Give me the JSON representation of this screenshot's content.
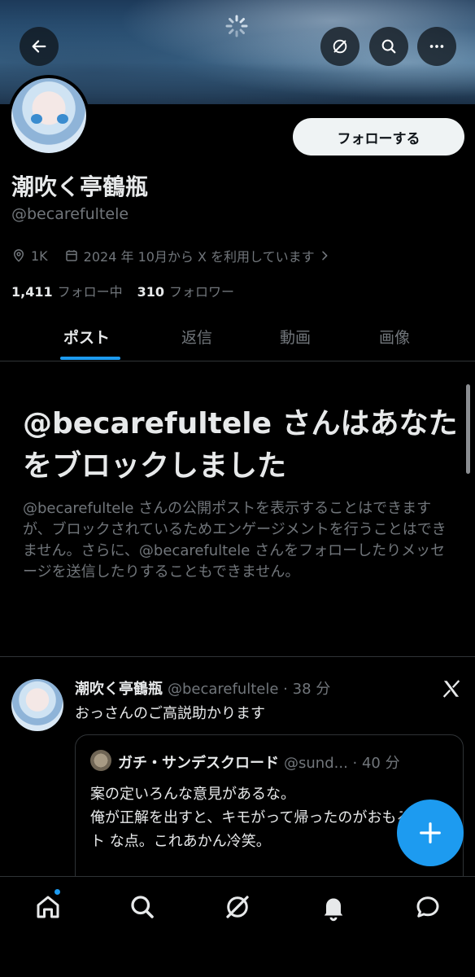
{
  "profile": {
    "follow_label": "フォローする",
    "display_name": "潮吹く亭鶴瓶",
    "handle": "@becarefultele",
    "location": "1K",
    "joined": "2024 年 10月から X を利用しています",
    "following_count": "1,411",
    "following_label": "フォロー中",
    "followers_count": "310",
    "followers_label": "フォロワー"
  },
  "tabs": [
    {
      "label": "ポスト",
      "active": true
    },
    {
      "label": "返信"
    },
    {
      "label": "動画"
    },
    {
      "label": "画像"
    }
  ],
  "blocked": {
    "title": "@becarefultele さんはあなたをブロックしました",
    "body": "@becarefultele さんの公開ポストを表示することはできますが、ブロックされているためエンゲージメントを行うことはできません。さらに、@becarefultele さんをフォローしたりメッセージを送信したりすることもできません。"
  },
  "post": {
    "name": "潮吹く亭鶴瓶",
    "handle_time": "@becarefultele · 38 分",
    "text": "おっさんのご高説助かります",
    "quote": {
      "name": "ガチ・サンデスクロード",
      "handle_time": "@sund... · 40 分",
      "line1": "案の定いろんな意見があるな。",
      "line2": "俺が正解を出すと、キモがって帰ったのがおもろ",
      "line3": "ト な点。これあかん冷笑。"
    }
  },
  "colors": {
    "accent": "#1d9bf0",
    "background": "#000000",
    "text_primary": "#e7e9ea",
    "text_secondary": "#71767b"
  },
  "icons": {
    "back": "arrow-left-icon",
    "grok": "grok-icon",
    "search": "search-icon",
    "more": "more-icon",
    "location": "location-pin-icon",
    "calendar": "calendar-icon",
    "x_logo": "x-logo-icon",
    "compose": "plus-icon",
    "home": "home-icon",
    "explore": "search-icon",
    "grok_nav": "grok-icon",
    "notifications": "bell-icon",
    "messages": "message-icon"
  }
}
